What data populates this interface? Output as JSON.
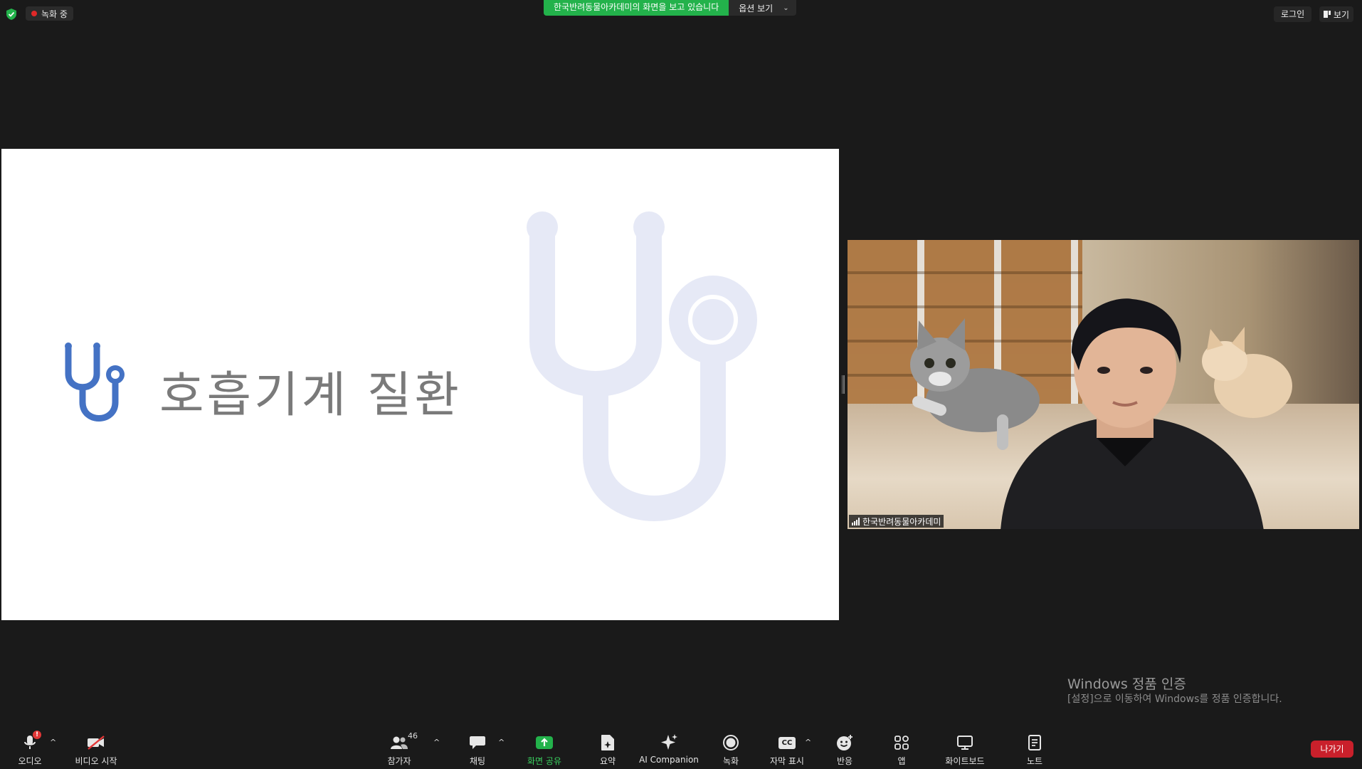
{
  "topbar": {
    "recording_label": "녹화 중",
    "share_banner": "한국반려동물아카데미의 화면을 보고 있습니다",
    "view_options": "옵션 보기",
    "login": "로그인",
    "view": "보기"
  },
  "slide": {
    "title": "호흡기계 질환",
    "icon_color": "#4472c4",
    "bg_icon_color": "#e6e9f6"
  },
  "video": {
    "participant_name": "한국반려동물아카데미"
  },
  "watermark": {
    "title": "Windows 정품 인증",
    "subtitle": "[설정]으로 이동하여 Windows를 정품 인증합니다."
  },
  "toolbar": {
    "audio": "오디오",
    "audio_badge": "!",
    "video_start": "비디오 시작",
    "participants": "참가자",
    "participants_count": "46",
    "chat": "채팅",
    "share_screen": "화면 공유",
    "summary": "요약",
    "ai_companion": "AI Companion",
    "record": "녹화",
    "captions": "자막 표시",
    "captions_icon": "CC",
    "reactions": "반응",
    "apps": "앱",
    "whiteboard": "화이트보드",
    "notes": "노트",
    "leave": "나가기"
  },
  "colors": {
    "accent_green": "#23b24b",
    "leave_red": "#c9202b",
    "background": "#1a1a1a"
  }
}
